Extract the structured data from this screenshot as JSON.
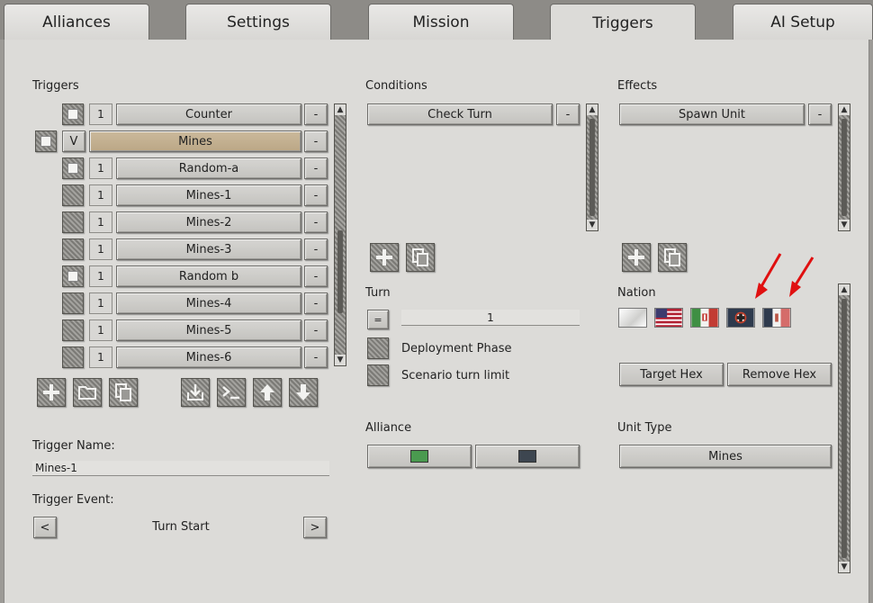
{
  "tabs": [
    {
      "label": "Alliances"
    },
    {
      "label": "Settings"
    },
    {
      "label": "Mission"
    },
    {
      "label": "Triggers"
    },
    {
      "label": "AI Setup"
    }
  ],
  "triggers": {
    "heading": "Triggers",
    "remove_label": "-",
    "rows": [
      {
        "num": "1",
        "name": "Counter",
        "checked": true
      },
      {
        "num": "V",
        "name": "Mines",
        "checked": true,
        "selected": true,
        "expanded": true
      },
      {
        "num": "1",
        "name": "Random-a",
        "checked": true
      },
      {
        "num": "1",
        "name": "Mines-1",
        "checked": false
      },
      {
        "num": "1",
        "name": "Mines-2",
        "checked": false
      },
      {
        "num": "1",
        "name": "Mines-3",
        "checked": false
      },
      {
        "num": "1",
        "name": "Random b",
        "checked": true
      },
      {
        "num": "1",
        "name": "Mines-4",
        "checked": false
      },
      {
        "num": "1",
        "name": "Mines-5",
        "checked": false
      },
      {
        "num": "1",
        "name": "Mines-6",
        "checked": false
      }
    ],
    "toolbar": [
      "plus-icon",
      "folder-icon",
      "copy-icon",
      "import-icon",
      "console-icon",
      "arrow-up-icon",
      "arrow-down-icon"
    ],
    "name_label": "Trigger Name:",
    "name_value": "Mines-1",
    "event_label": "Trigger Event:",
    "event_value": "Turn Start",
    "prev": "<",
    "next": ">"
  },
  "conditions": {
    "heading": "Conditions",
    "items": [
      {
        "name": "Check Turn"
      }
    ],
    "remove_label": "-",
    "turn_label": "Turn",
    "turn_operator": "=",
    "turn_value": "1",
    "deployment_label": "Deployment Phase",
    "scenario_limit_label": "Scenario turn limit",
    "alliance_label": "Alliance",
    "alliance_colors": [
      "#4a9a4f",
      "#3d4650"
    ]
  },
  "effects": {
    "heading": "Effects",
    "items": [
      {
        "name": "Spawn Unit"
      }
    ],
    "remove_label": "-",
    "nation_label": "Nation",
    "nations": [
      "white-flag-icon",
      "usa-flag-icon",
      "italy-kingdom-flag-icon",
      "germany-cross-flag-icon",
      "italy-social-republic-flag-icon"
    ],
    "target_hex": "Target Hex",
    "remove_hex": "Remove Hex",
    "unit_type_label": "Unit Type",
    "unit_type_value": "Mines"
  },
  "colors": {
    "selected_row": "#bfae8e",
    "arrow_red": "#e01010"
  }
}
